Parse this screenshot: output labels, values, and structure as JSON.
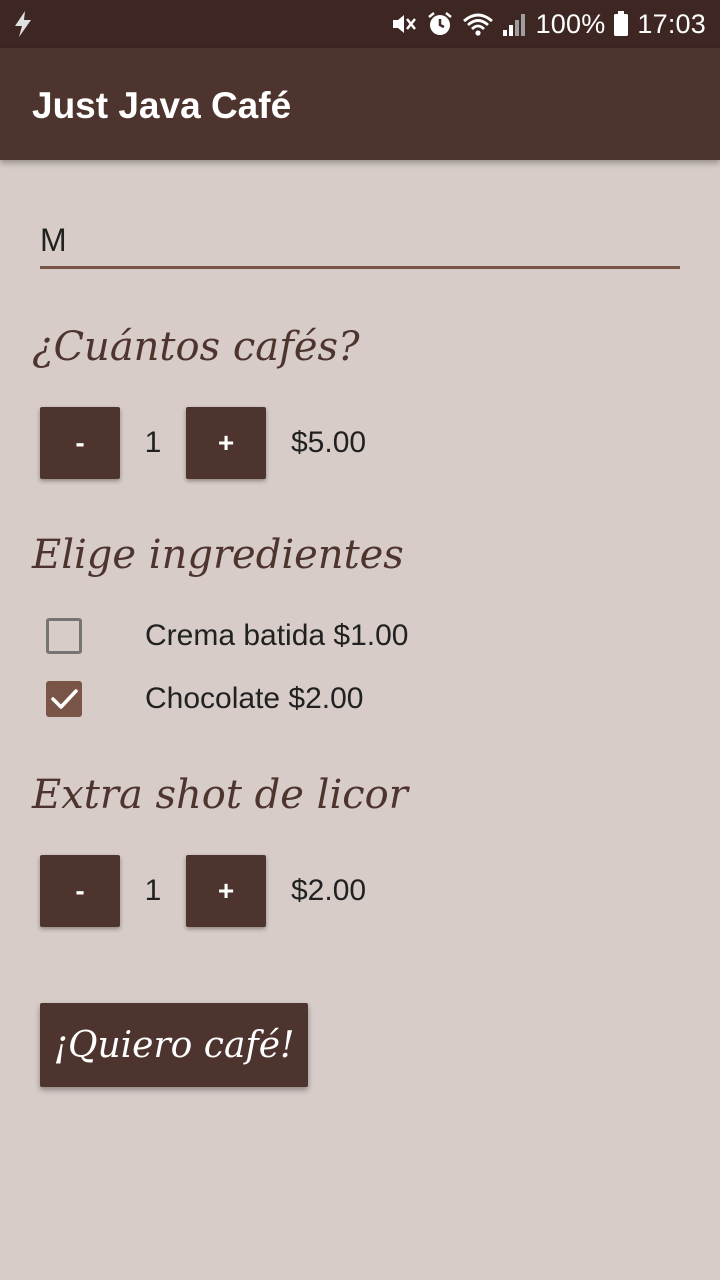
{
  "status_bar": {
    "left_icon": "flash-icon",
    "icons": [
      "mute-icon",
      "alarm-icon",
      "wifi-icon",
      "signal-icon",
      "battery-icon"
    ],
    "battery": "100%",
    "time": "17:03"
  },
  "app_bar": {
    "title": "Just Java Café"
  },
  "name_input": {
    "value": "M"
  },
  "coffee_section": {
    "heading": "¿Cuántos cafés?",
    "decrement_label": "-",
    "increment_label": "+",
    "quantity": "1",
    "price": "$5.00"
  },
  "ingredients_section": {
    "heading": "Elige ingredientes",
    "items": [
      {
        "label": "Crema batida $1.00",
        "checked": false
      },
      {
        "label": "Chocolate $2.00",
        "checked": true
      }
    ]
  },
  "liquor_section": {
    "heading": "Extra shot de licor",
    "decrement_label": "-",
    "increment_label": "+",
    "quantity": "1",
    "price": "$2.00"
  },
  "order_button": {
    "label": "¡Quiero café!"
  },
  "colors": {
    "status_bar": "#3e2723",
    "app_bar": "#4e342e",
    "background": "#d7ccc8",
    "accent": "#795548"
  }
}
